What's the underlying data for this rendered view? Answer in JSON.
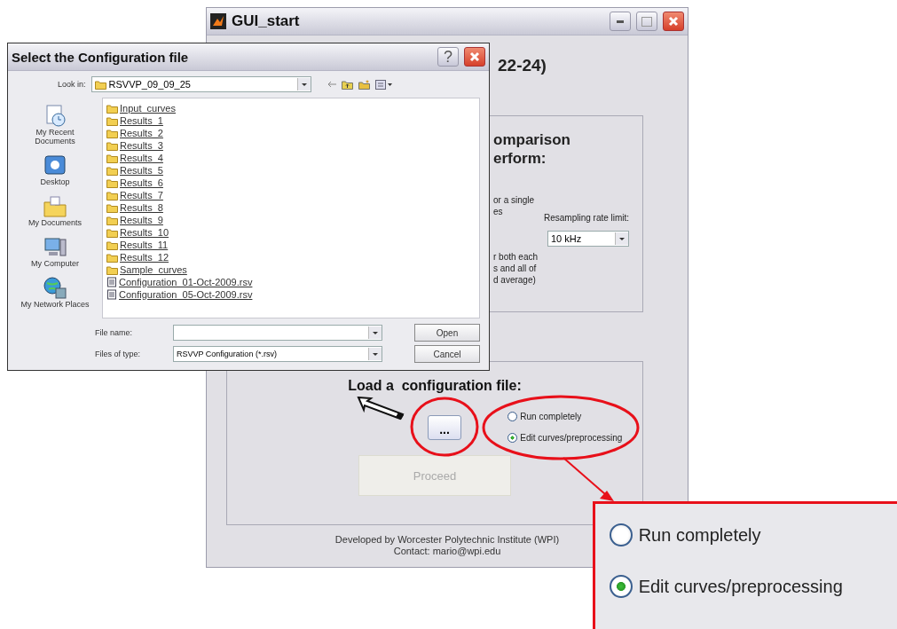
{
  "main_window": {
    "title": "GUI_start",
    "heading_fragment": "22-24)",
    "comparison_fragments": [
      "omparison",
      "erform:"
    ],
    "option_fragments": [
      [
        "or a single",
        "es"
      ],
      [
        "r both each",
        "s and all of",
        "d average)"
      ]
    ],
    "resampling": {
      "label": "Resampling rate limit:",
      "value": "10 kHz"
    },
    "load": {
      "title": "Load a  configuration file:",
      "browse_button": "...",
      "options": [
        {
          "label": "Run completely",
          "selected": false
        },
        {
          "label": "Edit curves/preprocessing",
          "selected": true
        }
      ],
      "proceed": {
        "label": "Proceed",
        "disabled": true
      }
    },
    "footer": [
      "Developed by Worcester Polytechnic Institute (WPI)",
      "Contact: mario@wpi.edu"
    ]
  },
  "dialog": {
    "title": "Select the Configuration file",
    "help_button": "?",
    "look_in": {
      "label": "Look in:",
      "value": "RSVVP_09_09_25"
    },
    "places": [
      {
        "label": "My Recent Documents",
        "kind": "recent"
      },
      {
        "label": "Desktop",
        "kind": "desktop"
      },
      {
        "label": "My Documents",
        "kind": "documents"
      },
      {
        "label": "My Computer",
        "kind": "computer"
      },
      {
        "label": "My Network Places",
        "kind": "network"
      }
    ],
    "files": [
      {
        "name": "Input_curves",
        "kind": "folder"
      },
      {
        "name": "Results_1",
        "kind": "folder"
      },
      {
        "name": "Results_2",
        "kind": "folder"
      },
      {
        "name": "Results_3",
        "kind": "folder"
      },
      {
        "name": "Results_4",
        "kind": "folder"
      },
      {
        "name": "Results_5",
        "kind": "folder"
      },
      {
        "name": "Results_6",
        "kind": "folder"
      },
      {
        "name": "Results_7",
        "kind": "folder"
      },
      {
        "name": "Results_8",
        "kind": "folder"
      },
      {
        "name": "Results_9",
        "kind": "folder"
      },
      {
        "name": "Results_10",
        "kind": "folder"
      },
      {
        "name": "Results_11",
        "kind": "folder"
      },
      {
        "name": "Results_12",
        "kind": "folder"
      },
      {
        "name": "Sample_curves",
        "kind": "folder"
      },
      {
        "name": "Configuration_01-Oct-2009.rsv",
        "kind": "file"
      },
      {
        "name": "Configuration_05-Oct-2009.rsv",
        "kind": "file"
      }
    ],
    "file_name": {
      "label": "File name:"
    },
    "files_of_type": {
      "label": "Files of type:",
      "value": "RSVVP Configuration (*.rsv)"
    },
    "buttons": [
      "Open",
      "Cancel"
    ]
  },
  "callout": {
    "options": [
      {
        "label": "Run completely",
        "selected": false
      },
      {
        "label": "Edit curves/preprocessing",
        "selected": true
      }
    ]
  }
}
